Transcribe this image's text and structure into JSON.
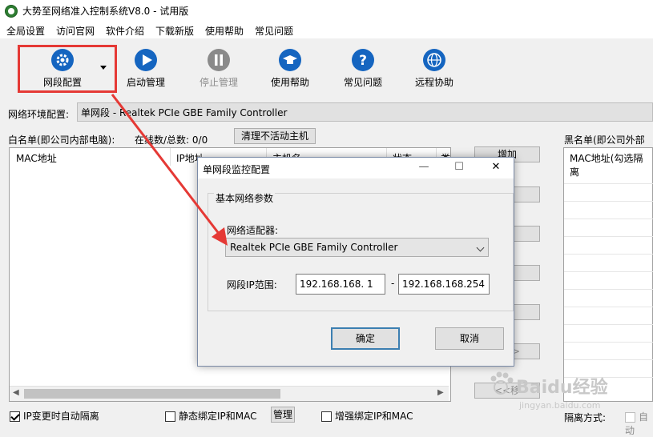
{
  "window": {
    "title": "大势至网络准入控制系统V8.0 - 试用版"
  },
  "menu": [
    "全局设置",
    "访问官网",
    "软件介绍",
    "下载新版",
    "使用帮助",
    "常见问题"
  ],
  "toolbar": {
    "segment_config": "网段配置",
    "start_manage": "启动管理",
    "stop_manage": "停止管理",
    "help": "使用帮助",
    "faq": "常见问题",
    "remote_help": "远程协助"
  },
  "env": {
    "label": "网络环境配置:",
    "value": "单网段 - Realtek PCIe GBE Family Controller"
  },
  "whitelist": {
    "label": "白名单(即公司内部电脑):",
    "online_label": "在线数/总数:  0/0",
    "clear_button": "清理不活动主机",
    "columns": [
      "MAC地址",
      "IP地址",
      "主机名",
      "状态",
      "类"
    ]
  },
  "middle_buttons": {
    "add": "增加",
    "to_black": "单>>",
    "to_white": "<<移"
  },
  "blacklist": {
    "label": "黑名单(即公司外部电",
    "column": "MAC地址(勾选隔离"
  },
  "options": {
    "ip_change_isolate": "IP变更时自动隔离",
    "static_bind": "静态绑定IP和MAC",
    "manage_btn": "管理",
    "enhanced_bind": "增强绑定IP和MAC",
    "isolate_mode": "隔离方式:",
    "auto_label": "自动"
  },
  "dialog": {
    "title": "单网段监控配置",
    "group_title": "基本网络参数",
    "adapter_label": "网络适配器:",
    "adapter_value": "Realtek PCIe GBE Family Controller",
    "range_label": "网段IP范围:",
    "ip_start": "192.168.168.  1",
    "ip_end": "192.168.168.254",
    "dash": "-",
    "ok": "确定",
    "cancel": "取消"
  },
  "watermark": {
    "brand": "Baidu经验",
    "url": "jingyan.baidu.com"
  },
  "colors": {
    "highlight": "#e53935",
    "icon_blue": "#1565c0",
    "icon_gray": "#8a8a8a"
  }
}
